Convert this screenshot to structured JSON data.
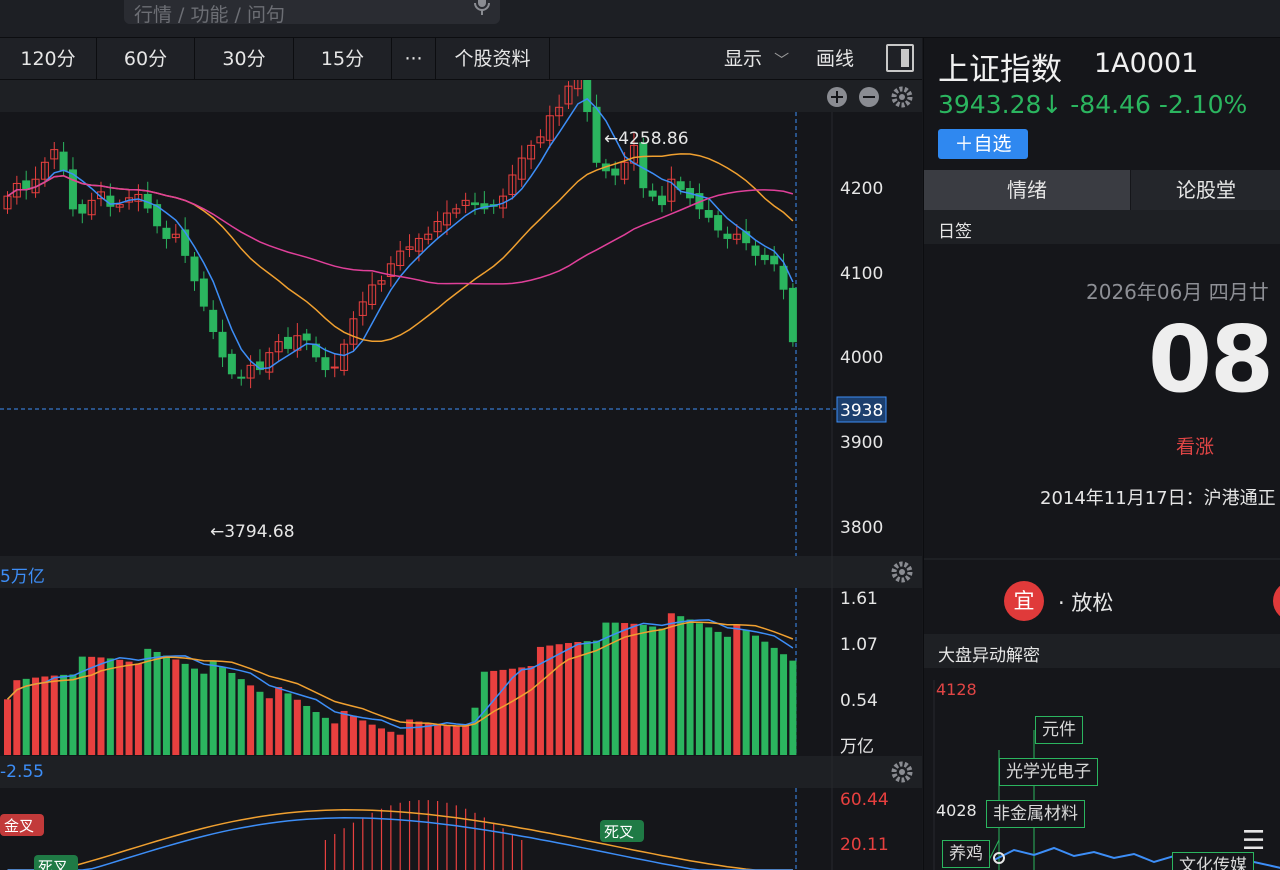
{
  "search": {
    "placeholder": "行情 / 功能 / 问句"
  },
  "toolbar": {
    "periods": [
      "120分",
      "60分",
      "30分",
      "15分"
    ],
    "more": "···",
    "profile": "个股资料",
    "display": "显示",
    "draw": "画线"
  },
  "chart": {
    "price_axis": [
      "4200",
      "4100",
      "4000",
      "3900",
      "3800"
    ],
    "current_price_tag": "3938",
    "high_label": "←4258.86",
    "low_label": "←3794.68",
    "volume_header": "5万亿",
    "volume_axis": [
      "1.61",
      "1.07",
      "0.54",
      "万亿"
    ],
    "macd_header": "-2.55",
    "macd_axis": [
      "60.44",
      "20.11"
    ],
    "golden_cross": "金叉",
    "death_cross_1": "死叉",
    "death_cross_2": "死叉",
    "colors": {
      "up": "#e8403f",
      "down": "#2bb55f",
      "ma5": "#3d8ef7",
      "ma10": "#f0a030",
      "ma20": "#e0409a"
    }
  },
  "quote": {
    "name": "上证指数",
    "code": "1A0001",
    "price_line": "3943.28↓ -84.46 -2.10%",
    "add_button": "＋自选"
  },
  "tabs": [
    "情绪",
    "论股堂"
  ],
  "sentiment": {
    "section": "日签",
    "date": "2026年06月 四月廿",
    "day": "08",
    "mood": "看涨",
    "event": "2014年11月17日：沪港通正",
    "advice_badge": "宜",
    "advice_text": "· 放松"
  },
  "anomaly": {
    "title": "大盘异动解密",
    "top_value": "4128",
    "mid_value": "4028",
    "tags": [
      "元件",
      "光学光电子",
      "非金属材料",
      "养鸡",
      "文化传媒"
    ]
  },
  "chart_data": {
    "type": "candlestick",
    "title": "上证指数",
    "ylim": [
      3760,
      4290
    ],
    "high": 4258.86,
    "low": 3794.68,
    "last": 3938,
    "volume_ylim": [
      0,
      1.61
    ],
    "macd_ylim": [
      0,
      60.44
    ]
  }
}
